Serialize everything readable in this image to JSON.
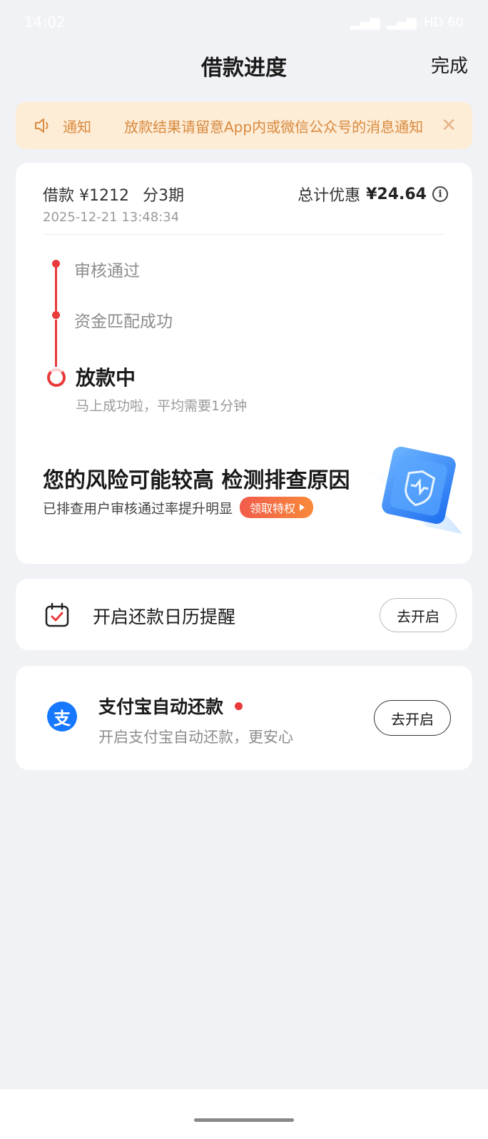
{
  "status_bar": {
    "time": "14:02",
    "indicators": "HD 60"
  },
  "nav": {
    "title": "借款进度",
    "done_label": "完成"
  },
  "notice": {
    "label": "通知",
    "text": "放款结果请留意App内或微信公众号的消息通知",
    "icon": "speaker-icon",
    "close_icon": "close-icon"
  },
  "loan": {
    "amount_label": "借款 ¥1212",
    "installments": "分3期",
    "date": "2025-12-21 13:48:34",
    "discount_label": "总计优惠",
    "discount_amount": "¥24.64"
  },
  "progress": {
    "steps": [
      {
        "label": "审核通过",
        "state": "done"
      },
      {
        "label": "资金匹配成功",
        "state": "done"
      }
    ],
    "current": {
      "label": "放款中",
      "sub": "马上成功啦，平均需要1分钟"
    }
  },
  "risk": {
    "title": "您的风险可能较高 检测排查原因",
    "sub": "已排查用户审核通过率提升明显",
    "button": "领取特权"
  },
  "calendar": {
    "text": "开启还款日历提醒",
    "button": "去开启"
  },
  "alipay": {
    "logo": "支",
    "title": "支付宝自动还款",
    "sub": "开启支付宝自动还款，更安心",
    "button": "去开启"
  },
  "colors": {
    "accent": "#e83a3a",
    "notice_bg": "#fdecd6",
    "notice_text": "#d98a3f",
    "alipay_blue": "#1677ff"
  }
}
